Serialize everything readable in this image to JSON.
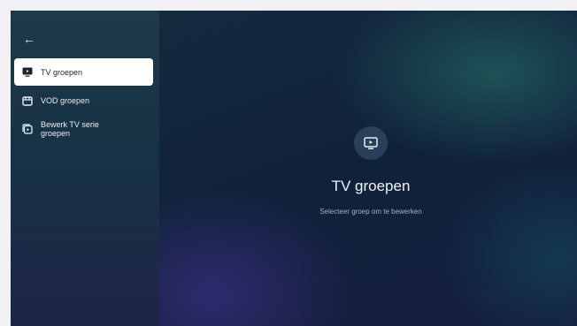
{
  "sidebar": {
    "back_icon": "arrow-left-icon",
    "items": [
      {
        "label": "TV groepen",
        "icon": "tv-icon",
        "selected": true
      },
      {
        "label": "VOD groepen",
        "icon": "film-icon",
        "selected": false
      },
      {
        "label": "Bewerk TV serie groepen",
        "icon": "series-icon",
        "selected": false
      }
    ]
  },
  "main": {
    "icon": "tv-icon",
    "title": "TV groepen",
    "subtitle": "Selecteer groep om te bewerken"
  },
  "colors": {
    "selected_bg": "#ffffff",
    "sidebar_bg": "#1d3a48",
    "content_bg": "#10223a",
    "title_text": "#eef3f7",
    "subtitle_text": "#9fb0bf"
  }
}
